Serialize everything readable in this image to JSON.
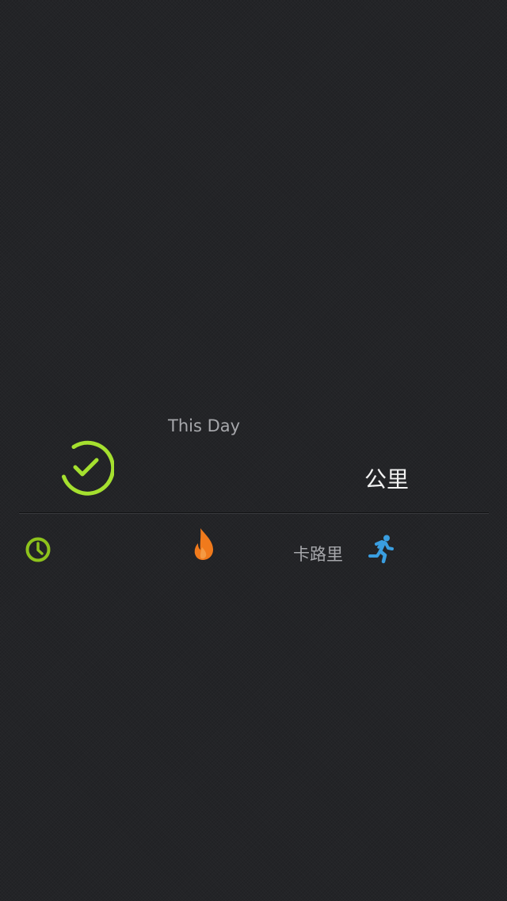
{
  "summary": {
    "period_label": "This Day",
    "distance_unit": "公里",
    "calorie_unit": "卡路里"
  },
  "icons": {
    "status": {
      "name": "check-circle-icon",
      "color": "#a5e02f"
    },
    "duration": {
      "name": "clock-icon",
      "color": "#8ec31c"
    },
    "calories": {
      "name": "flame-icon",
      "color": "#f07a1c"
    },
    "activity": {
      "name": "running-person-icon",
      "color": "#3a9ee0"
    }
  }
}
